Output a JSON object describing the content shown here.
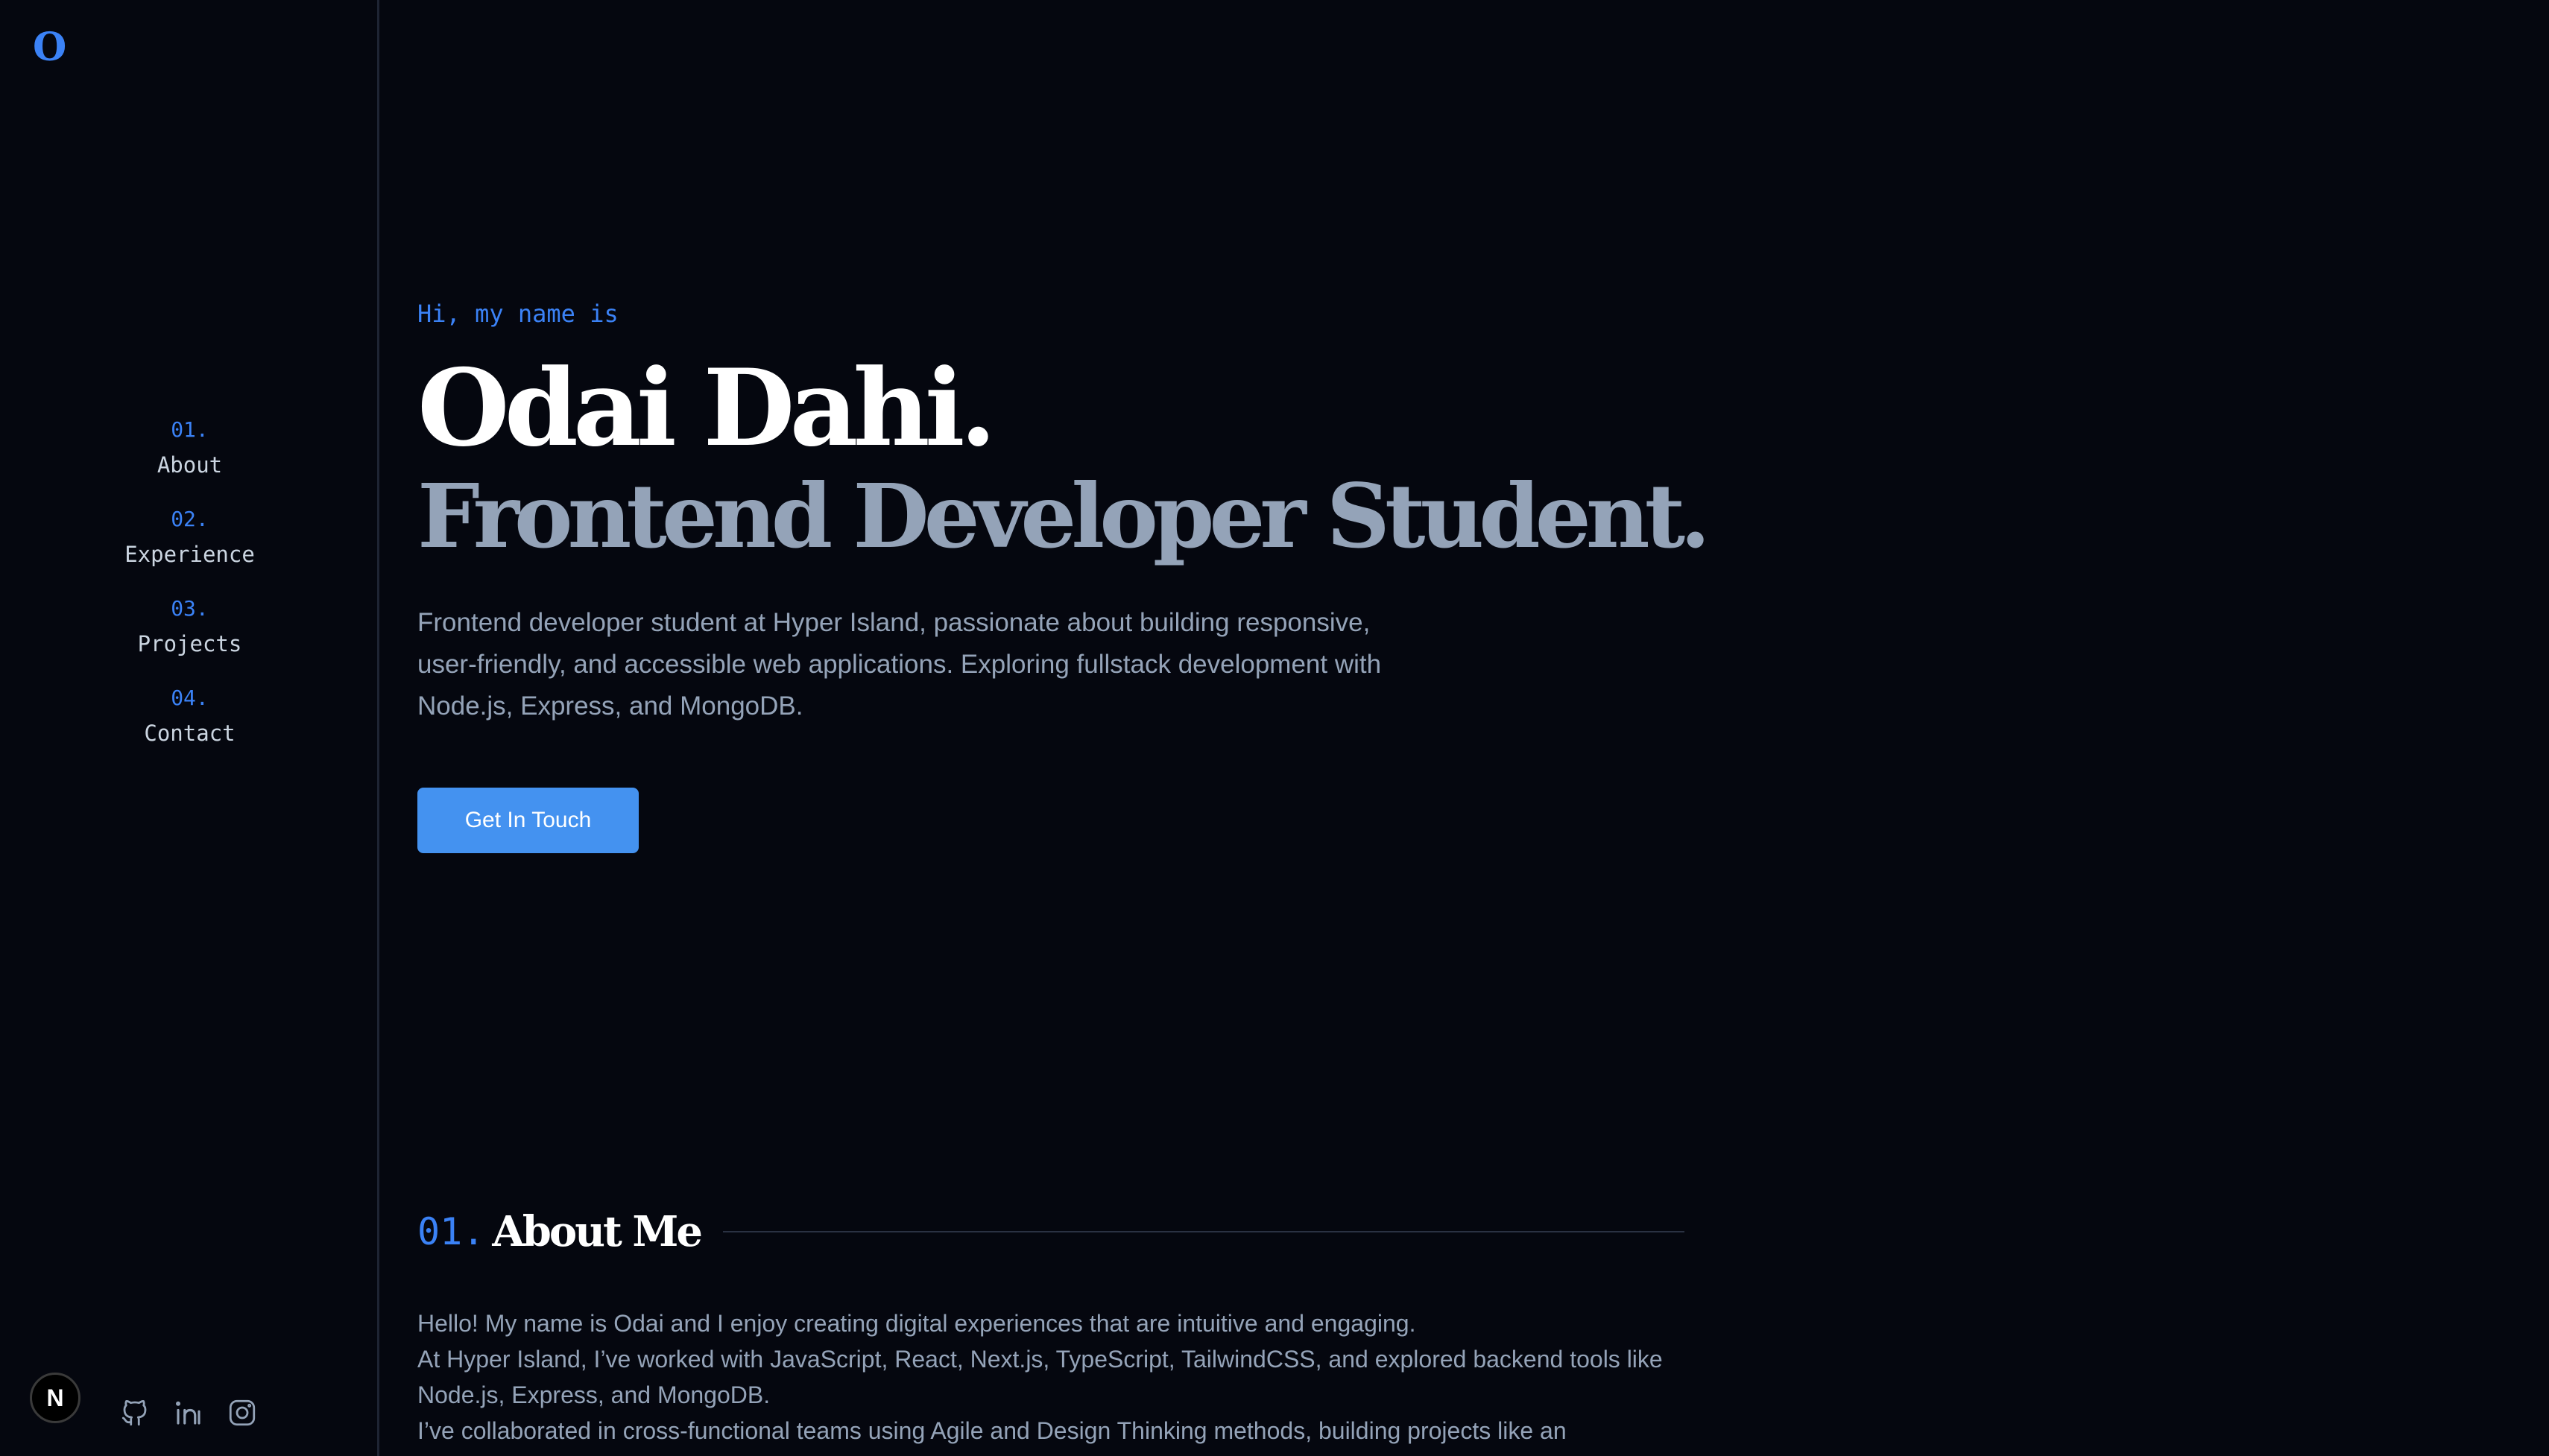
{
  "sidebar": {
    "logo": "O",
    "nav": [
      {
        "num": "01.",
        "label": "About"
      },
      {
        "num": "02.",
        "label": "Experience"
      },
      {
        "num": "03.",
        "label": "Projects"
      },
      {
        "num": "04.",
        "label": "Contact"
      }
    ],
    "next_badge": "N",
    "socials": [
      "github-icon",
      "linkedin-icon",
      "instagram-icon"
    ]
  },
  "hero": {
    "greeting": "Hi, my name is",
    "name": "Odai Dahi.",
    "role": "Frontend Developer Student.",
    "description": "Frontend developer student at Hyper Island, passionate about building responsive, user-friendly, and accessible web applications. Exploring fullstack development with Node.js, Express, and MongoDB.",
    "cta": "Get In Touch"
  },
  "about": {
    "num": "01.",
    "title": "About Me",
    "paragraphs": [
      "Hello! My name is Odai and I enjoy creating digital experiences that are intuitive and engaging.",
      "At Hyper Island, I’ve worked with JavaScript, React, Next.js, TypeScript, TailwindCSS, and explored backend tools like Node.js, Express, and MongoDB.",
      "I’ve collaborated in cross-functional teams using Agile and Design Thinking methods, building projects like an"
    ]
  },
  "colors": {
    "background": "#05070f",
    "accent": "#3b82f6",
    "button": "#4492f0",
    "muted_text": "#94a3b8",
    "heading_text": "#ffffff"
  }
}
